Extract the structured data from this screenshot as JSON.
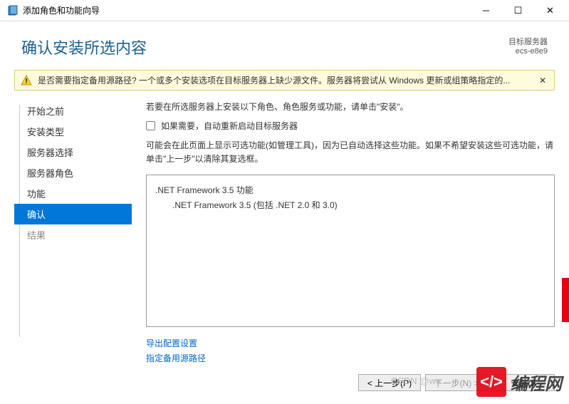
{
  "titlebar": {
    "title": "添加角色和功能向导"
  },
  "header": {
    "title": "确认安装所选内容",
    "target_label": "目标服务器",
    "target_server": "ecs-e8e9"
  },
  "warning": {
    "text": "是否需要指定备用源路径? 一个或多个安装选项在目标服务器上缺少源文件。服务器将尝试从 Windows 更新或组策略指定的..."
  },
  "sidebar": {
    "items": [
      {
        "label": "开始之前",
        "state": "done"
      },
      {
        "label": "安装类型",
        "state": "done"
      },
      {
        "label": "服务器选择",
        "state": "done"
      },
      {
        "label": "服务器角色",
        "state": "done"
      },
      {
        "label": "功能",
        "state": "done"
      },
      {
        "label": "确认",
        "state": "active"
      },
      {
        "label": "结果",
        "state": "pending"
      }
    ]
  },
  "main": {
    "instruction1": "若要在所选服务器上安装以下角色、角色服务或功能，请单击\"安装\"。",
    "checkbox_label": "如果需要，自动重新启动目标服务器",
    "instruction2": "可能会在此页面上显示可选功能(如管理工具)，因为已自动选择这些功能。如果不希望安装这些可选功能，请单击\"上一步\"以清除其复选框。",
    "features": [
      {
        "label": ".NET Framework 3.5 功能",
        "sub": ".NET Framework 3.5 (包括 .NET 2.0 和 3.0)"
      }
    ],
    "links": {
      "export": "导出配置设置",
      "alt_source": "指定备用源路径"
    }
  },
  "footer": {
    "prev": "< 上一步(P)",
    "next": "下一步(N) >",
    "install": "安装(I)"
  },
  "watermark": {
    "csdn": "CSDN @we",
    "logo": "</>",
    "brand": "编程网"
  }
}
